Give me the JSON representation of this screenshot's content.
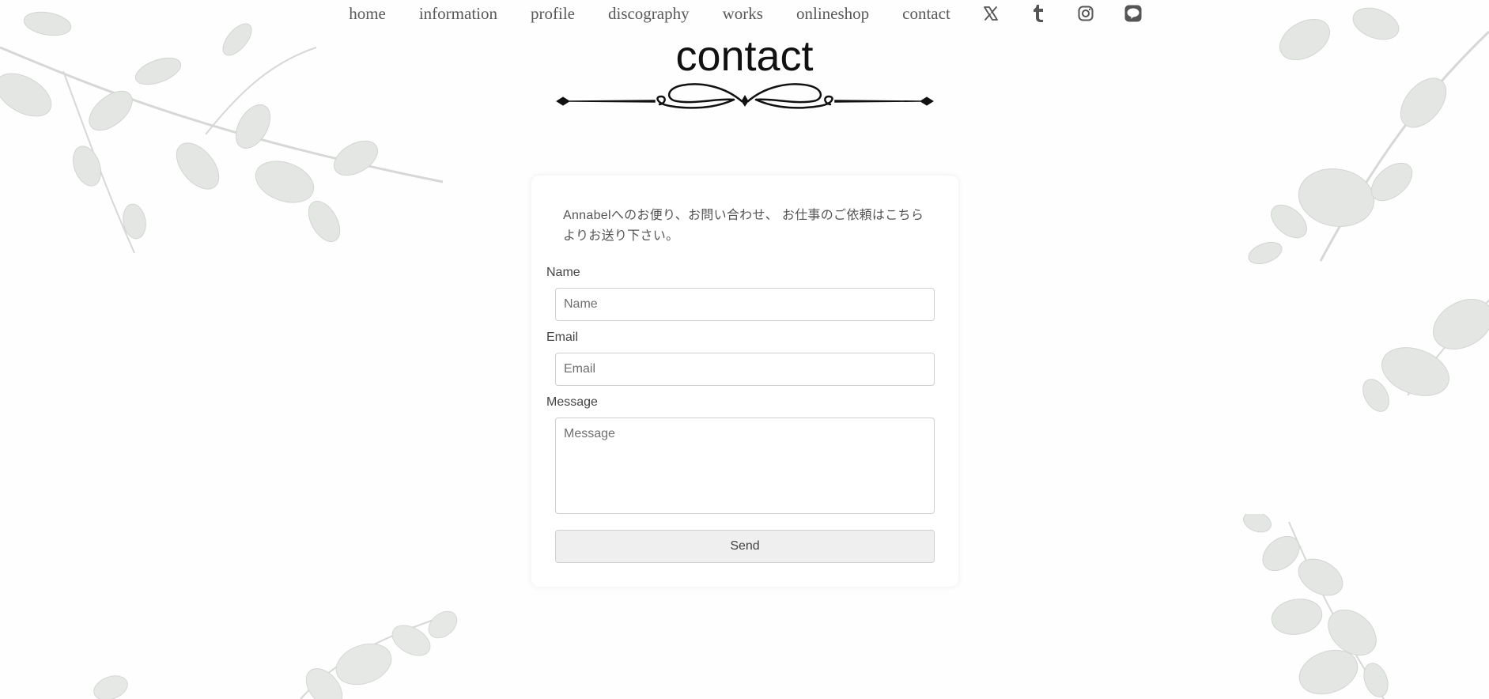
{
  "nav": {
    "links": [
      {
        "label": "home"
      },
      {
        "label": "information"
      },
      {
        "label": "profile"
      },
      {
        "label": "discography"
      },
      {
        "label": "works"
      },
      {
        "label": "onlineshop"
      },
      {
        "label": "contact"
      }
    ],
    "social_icons": [
      "x-icon",
      "tumblr-icon",
      "instagram-icon",
      "line-icon"
    ]
  },
  "page": {
    "title": "contact"
  },
  "form": {
    "intro": "Annabelへのお便り、お問い合わせ、 お仕事のご依頼はこちらよりお送り下さい。",
    "name_label": "Name",
    "name_placeholder": "Name",
    "email_label": "Email",
    "email_placeholder": "Email",
    "message_label": "Message",
    "message_placeholder": "Message",
    "send_label": "Send"
  },
  "colors": {
    "background": "#fefefe",
    "nav_text": "#595959",
    "icon": "#555555",
    "title": "#111111",
    "card": "#ffffff",
    "button": "#efefef",
    "leaf": "#e3e5e3"
  }
}
